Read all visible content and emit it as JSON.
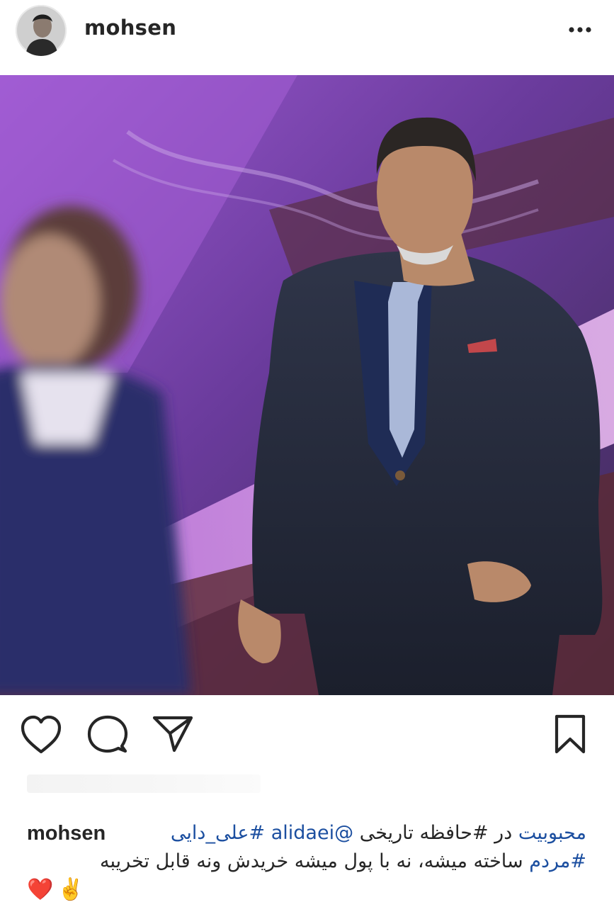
{
  "post": {
    "username": "mohsen",
    "avatar_icon": "profile-photo",
    "more_icon": "ellipsis-icon"
  },
  "photo": {
    "icon": "stage-photo",
    "colors": {
      "stage_purple": "#7a3fae",
      "suit": "#252b3d",
      "tie": "#a9b7d6"
    }
  },
  "actions": {
    "like_icon": "heart-icon",
    "comment_icon": "comment-icon",
    "share_icon": "send-icon",
    "save_icon": "bookmark-icon"
  },
  "caption": {
    "username": "mohsen",
    "line1_tag1": "#علی_دایی",
    "line1_mention": "@alidaei",
    "line1_tag2": "#حافظه تاریخی",
    "line1_text": "در",
    "line1_tag3": "محبوبیت",
    "line2_tag": "#مردم",
    "line2_text": "ساخته میشه، نه با پول میشه خریدش ونه قابل تخریبه",
    "line3_emoji": "❤️✌️"
  },
  "colors": {
    "hashtag": "#1c4fa0",
    "text": "#262626"
  }
}
